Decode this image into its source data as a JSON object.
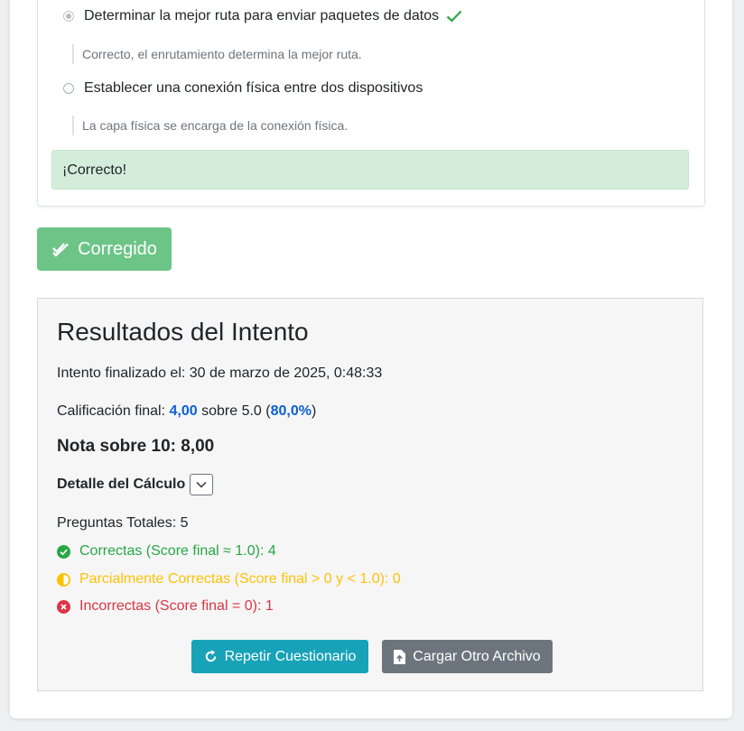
{
  "question": {
    "options": [
      {
        "label": "Determinar la mejor ruta para enviar paquetes de datos",
        "selected": true,
        "correct": true,
        "feedback": "Correcto, el enrutamiento determina la mejor ruta."
      },
      {
        "label": "Establecer una conexión física entre dos dispositivos",
        "selected": false,
        "correct": false,
        "feedback": "La capa física se encarga de la conexión física."
      }
    ],
    "result_message": "¡Correcto!"
  },
  "corrected_button": {
    "label": "Corregido",
    "icon": "double-check-icon"
  },
  "results": {
    "title": "Resultados del Intento",
    "finished_prefix": "Intento finalizado el:",
    "finished_date": "30 de marzo de 2025, 0:48:33",
    "grade_prefix": "Calificación final:",
    "grade_value": "4,00",
    "grade_mid": "sobre 5.0 (",
    "grade_percent": "80,0%",
    "grade_suffix": ")",
    "score10": "Nota sobre 10: 8,00",
    "detail_label": "Detalle del Cálculo",
    "total_questions": "Preguntas Totales: 5",
    "correct": "Correctas (Score final ≈ 1.0): 4",
    "partial": "Parcialmente Correctas (Score final > 0 y < 1.0): 0",
    "incorrect": "Incorrectas (Score final = 0): 1",
    "repeat_button": "Repetir Cuestionario",
    "load_button": "Cargar Otro Archivo"
  },
  "colors": {
    "success": "#28a745",
    "warning": "#ffc107",
    "danger": "#dc3545",
    "info": "#17a2b8",
    "secondary": "#6c757d",
    "highlight": "#0b5ed7"
  }
}
